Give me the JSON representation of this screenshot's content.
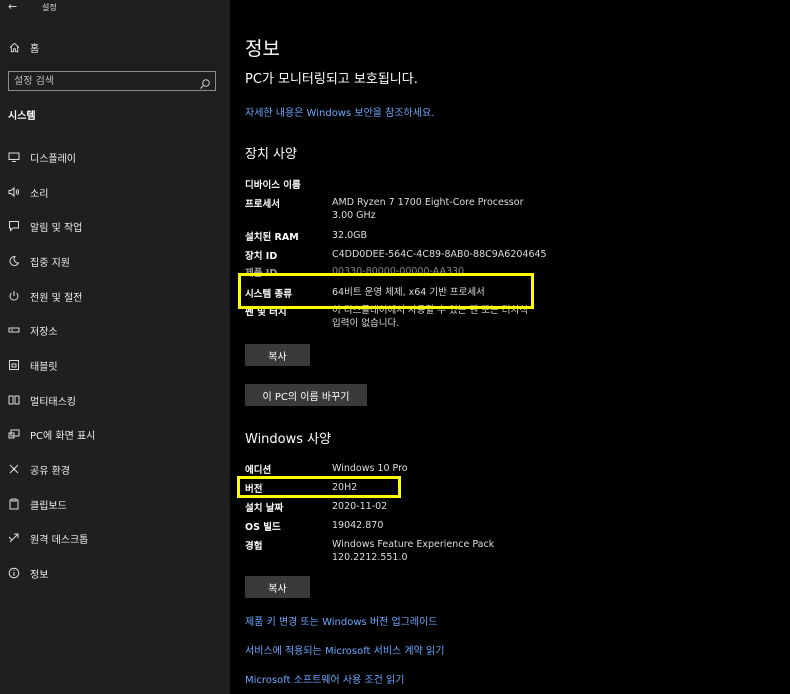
{
  "window": {
    "title": "설정",
    "back_glyph": "←"
  },
  "sidebar": {
    "home_label": "홈",
    "search_placeholder": "설정 검색",
    "section_heading": "시스템",
    "items": [
      {
        "label": "디스플레이",
        "icon": "monitor-icon"
      },
      {
        "label": "소리",
        "icon": "speaker-icon"
      },
      {
        "label": "알림 및 작업",
        "icon": "notification-icon"
      },
      {
        "label": "집중 지원",
        "icon": "moon-icon"
      },
      {
        "label": "전원 및 절전",
        "icon": "power-icon"
      },
      {
        "label": "저장소",
        "icon": "storage-icon"
      },
      {
        "label": "태블릿",
        "icon": "tablet-icon"
      },
      {
        "label": "멀티태스킹",
        "icon": "multitasking-icon"
      },
      {
        "label": "PC에 화면 표시",
        "icon": "project-icon"
      },
      {
        "label": "공유 환경",
        "icon": "share-icon"
      },
      {
        "label": "클립보드",
        "icon": "clipboard-icon"
      },
      {
        "label": "원격 데스크톱",
        "icon": "remote-desktop-icon"
      },
      {
        "label": "정보",
        "icon": "info-icon"
      }
    ]
  },
  "main": {
    "title": "정보",
    "protect_text": "PC가 모니터링되고 보호됩니다.",
    "security_link": "자세한 내용은 Windows 보안을 참조하세요.",
    "device_heading": "장치 사양",
    "device_specs": [
      {
        "key": "디바이스 이름",
        "value": ""
      },
      {
        "key": "프로세서",
        "value": "AMD Ryzen 7 1700 Eight-Core Processor",
        "value2": "3.00 GHz"
      },
      {
        "key": "설치된 RAM",
        "value": "32.0GB"
      },
      {
        "key": "장치 ID",
        "value": "C4DD0DEE-564C-4C89-8AB0-88C9A6204645"
      },
      {
        "key": "제품 ID",
        "value": "00330-80000-00000-AA330"
      },
      {
        "key": "시스템 종류",
        "value": "64비트 운영 체제, x64 기반 프로세서"
      },
      {
        "key": "펜 및 터치",
        "value": "이 디스플레이에서 사용할 수 있는 펜 또는 터치식",
        "value2": "입력이 없습니다."
      }
    ],
    "copy_button": "복사",
    "rename_button": "이 PC의 이름 바꾸기",
    "windows_heading": "Windows 사양",
    "windows_specs": [
      {
        "key": "에디션",
        "value": "Windows 10 Pro"
      },
      {
        "key": "버전",
        "value": "20H2"
      },
      {
        "key": "설치 날짜",
        "value": "2020-11-02"
      },
      {
        "key": "OS 빌드",
        "value": "19042.870"
      },
      {
        "key": "경험",
        "value": "Windows Feature Experience Pack",
        "value2": "120.2212.551.0"
      }
    ],
    "copy_button2": "복사",
    "links": [
      "제품 키 변경 또는 Windows 버전 업그레이드",
      "서비스에 적용되는 Microsoft 서비스 계약 읽기",
      "Microsoft 소프트웨어 사용 조건 읽기"
    ]
  },
  "colors": {
    "highlight": "#ffff00",
    "link": "#6aa8ff",
    "sidebar_bg": "#1f1f1f",
    "main_bg": "#000000"
  }
}
